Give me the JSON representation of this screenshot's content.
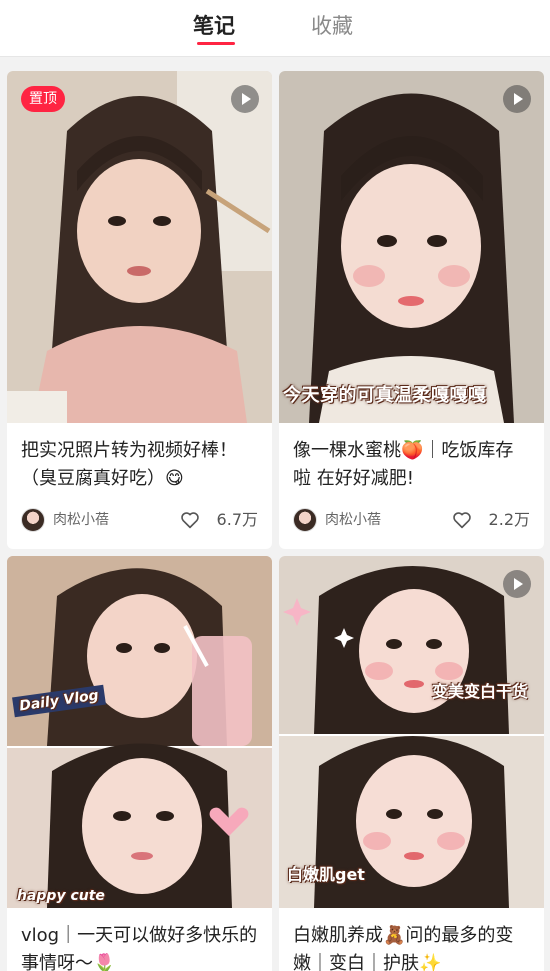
{
  "tabs": {
    "notes": "笔记",
    "collections": "收藏"
  },
  "accent_color": "#ff2442",
  "cards": [
    {
      "badge": "置顶",
      "title": "把实况照片转为视频好棒！（臭豆腐真好吃）😋",
      "author": "肉松小蓓",
      "likes": "6.7万"
    },
    {
      "overlay": "今天穿的可真温柔嘎嘎嘎",
      "title": "像一棵水蜜桃🍑｜吃饭库存啦 在好好减肥!",
      "author": "肉松小蓓",
      "likes": "2.2万"
    },
    {
      "overlay_a": "Daily Vlog",
      "overlay_b": "happy cute",
      "title": "vlog｜一天可以做好多快乐的事情呀～🌷"
    },
    {
      "overlay_a": "变美变白干货",
      "overlay_b": "白嫩肌get",
      "title": "白嫩肌养成🧸问的最多的变嫩｜变白｜护肤✨"
    }
  ]
}
